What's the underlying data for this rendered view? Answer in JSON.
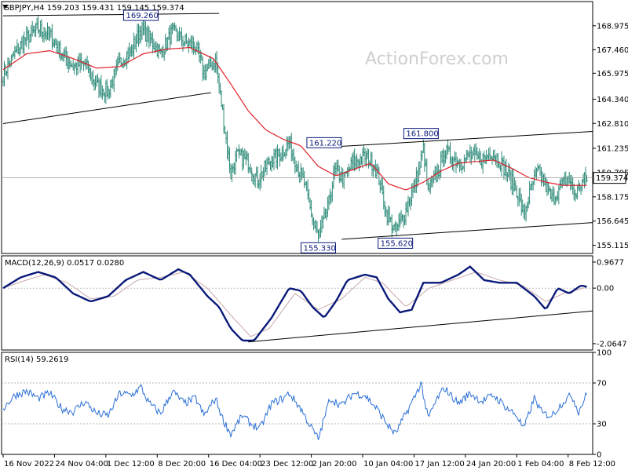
{
  "watermark": "ActionForex.com",
  "colors": {
    "price_bars": "#2e8b7a",
    "ema": "#e0202a",
    "macd": "#0a1a7a",
    "signal": "#c8a8a8",
    "rsi": "#2a6fd6",
    "trendline": "#000000",
    "callout_border": "#0a1a7a",
    "callout_text": "#0a1a7a",
    "frame": "#000000"
  },
  "chart_data": [
    {
      "panel": "price",
      "type": "bar",
      "header": "GBPJPY,H4  159.203 159.431 159.145 159.374",
      "ylim": [
        154.6,
        170.5
      ],
      "y_ticks": [
        168.975,
        167.46,
        165.975,
        164.34,
        162.81,
        161.235,
        159.705,
        158.175,
        156.645,
        155.115
      ],
      "last_price_label": "159.374",
      "last_price": 159.374,
      "x_tick_labels": [
        "16 Nov 2022",
        "24 Nov 04:00",
        "1 Dec 12:00",
        "8 Dec 20:00",
        "16 Dec 04:00",
        "23 Dec 12:00",
        "2 Jan 20:00",
        "10 Jan 04:00",
        "17 Jan 12:00",
        "24 Jan 20:00",
        "1 Feb 04:00",
        "8 Feb 12:00"
      ],
      "x_tick_index": [
        0,
        44,
        88,
        132,
        176,
        220,
        264,
        308,
        352,
        396,
        440,
        484
      ],
      "callouts": [
        {
          "label": "169.260",
          "bar": 118,
          "price": 169.26,
          "side": "above"
        },
        {
          "label": "161.220",
          "bar": 275,
          "price": 161.22,
          "side": "above"
        },
        {
          "label": "161.800",
          "bar": 358,
          "price": 161.8,
          "side": "above"
        },
        {
          "label": "155.330",
          "bar": 270,
          "price": 155.33,
          "side": "below"
        },
        {
          "label": "155.620",
          "bar": 336,
          "price": 155.62,
          "side": "below"
        }
      ],
      "trendlines": [
        {
          "name": "upper-channel-top",
          "bar1": 0,
          "p1": 169.6,
          "bar2": 185,
          "p2": 169.75
        },
        {
          "name": "upper-channel-bottom",
          "bar1": 0,
          "p1": 162.8,
          "bar2": 178,
          "p2": 164.75
        },
        {
          "name": "range-top",
          "bar1": 275,
          "p1": 161.3,
          "bar2": 510,
          "p2": 162.3
        },
        {
          "name": "range-bottom",
          "bar1": 290,
          "p1": 155.5,
          "bar2": 510,
          "p2": 156.55
        }
      ],
      "path_nodes": [
        {
          "i": 0,
          "v": 165.9
        },
        {
          "i": 10,
          "v": 167.2
        },
        {
          "i": 20,
          "v": 168.2
        },
        {
          "i": 30,
          "v": 168.8
        },
        {
          "i": 40,
          "v": 168.4
        },
        {
          "i": 50,
          "v": 167.2
        },
        {
          "i": 60,
          "v": 166.4
        },
        {
          "i": 70,
          "v": 166.6
        },
        {
          "i": 80,
          "v": 165.2
        },
        {
          "i": 90,
          "v": 164.8
        },
        {
          "i": 100,
          "v": 166.7
        },
        {
          "i": 110,
          "v": 167.4
        },
        {
          "i": 118,
          "v": 168.8
        },
        {
          "i": 125,
          "v": 168.2
        },
        {
          "i": 135,
          "v": 167.2
        },
        {
          "i": 145,
          "v": 168.6
        },
        {
          "i": 155,
          "v": 168.0
        },
        {
          "i": 165,
          "v": 167.6
        },
        {
          "i": 172,
          "v": 166.0
        },
        {
          "i": 182,
          "v": 166.8
        },
        {
          "i": 188,
          "v": 163.5
        },
        {
          "i": 195,
          "v": 159.6
        },
        {
          "i": 200,
          "v": 160.8
        },
        {
          "i": 210,
          "v": 160.4
        },
        {
          "i": 218,
          "v": 159.2
        },
        {
          "i": 228,
          "v": 160.4
        },
        {
          "i": 238,
          "v": 160.9
        },
        {
          "i": 245,
          "v": 161.6
        },
        {
          "i": 252,
          "v": 160.1
        },
        {
          "i": 258,
          "v": 159.0
        },
        {
          "i": 265,
          "v": 156.8
        },
        {
          "i": 270,
          "v": 155.6
        },
        {
          "i": 278,
          "v": 157.4
        },
        {
          "i": 284,
          "v": 159.8
        },
        {
          "i": 292,
          "v": 159.3
        },
        {
          "i": 300,
          "v": 160.4
        },
        {
          "i": 310,
          "v": 160.7
        },
        {
          "i": 318,
          "v": 160.2
        },
        {
          "i": 322,
          "v": 159.3
        },
        {
          "i": 328,
          "v": 157.2
        },
        {
          "i": 336,
          "v": 156.0
        },
        {
          "i": 344,
          "v": 157.1
        },
        {
          "i": 350,
          "v": 158.4
        },
        {
          "i": 356,
          "v": 159.8
        },
        {
          "i": 360,
          "v": 161.2
        },
        {
          "i": 364,
          "v": 158.6
        },
        {
          "i": 372,
          "v": 159.6
        },
        {
          "i": 378,
          "v": 161.1
        },
        {
          "i": 385,
          "v": 160.6
        },
        {
          "i": 392,
          "v": 160.3
        },
        {
          "i": 400,
          "v": 160.8
        },
        {
          "i": 410,
          "v": 160.5
        },
        {
          "i": 418,
          "v": 161.0
        },
        {
          "i": 426,
          "v": 160.4
        },
        {
          "i": 432,
          "v": 159.6
        },
        {
          "i": 440,
          "v": 158.6
        },
        {
          "i": 446,
          "v": 157.0
        },
        {
          "i": 452,
          "v": 158.6
        },
        {
          "i": 458,
          "v": 159.8
        },
        {
          "i": 464,
          "v": 159.0
        },
        {
          "i": 470,
          "v": 158.0
        },
        {
          "i": 478,
          "v": 158.8
        },
        {
          "i": 484,
          "v": 159.4
        },
        {
          "i": 490,
          "v": 158.3
        },
        {
          "i": 495,
          "v": 159.0
        },
        {
          "i": 500,
          "v": 159.374
        }
      ],
      "ema_nodes": [
        {
          "i": 0,
          "v": 166.2
        },
        {
          "i": 20,
          "v": 167.2
        },
        {
          "i": 40,
          "v": 167.4
        },
        {
          "i": 60,
          "v": 166.9
        },
        {
          "i": 80,
          "v": 166.3
        },
        {
          "i": 100,
          "v": 166.4
        },
        {
          "i": 120,
          "v": 167.2
        },
        {
          "i": 140,
          "v": 167.5
        },
        {
          "i": 160,
          "v": 167.6
        },
        {
          "i": 180,
          "v": 166.9
        },
        {
          "i": 195,
          "v": 165.3
        },
        {
          "i": 210,
          "v": 163.6
        },
        {
          "i": 225,
          "v": 162.4
        },
        {
          "i": 240,
          "v": 161.8
        },
        {
          "i": 255,
          "v": 161.4
        },
        {
          "i": 270,
          "v": 160.1
        },
        {
          "i": 285,
          "v": 159.5
        },
        {
          "i": 300,
          "v": 159.9
        },
        {
          "i": 315,
          "v": 160.3
        },
        {
          "i": 330,
          "v": 159.0
        },
        {
          "i": 345,
          "v": 158.6
        },
        {
          "i": 360,
          "v": 159.1
        },
        {
          "i": 375,
          "v": 159.8
        },
        {
          "i": 390,
          "v": 160.3
        },
        {
          "i": 405,
          "v": 160.4
        },
        {
          "i": 420,
          "v": 160.5
        },
        {
          "i": 435,
          "v": 160.0
        },
        {
          "i": 450,
          "v": 159.4
        },
        {
          "i": 465,
          "v": 159.1
        },
        {
          "i": 480,
          "v": 158.9
        },
        {
          "i": 500,
          "v": 158.9
        }
      ]
    },
    {
      "panel": "macd",
      "type": "line",
      "header": "MACD(12,26,9) 0.0517 0.0280",
      "ylim": [
        -2.3,
        1.2
      ],
      "y_ticks": [
        0.9677,
        0.0,
        -2.0647
      ],
      "y_tick_labels": [
        "0.9677",
        "0.00",
        "-2.0647"
      ],
      "macd_nodes": [
        {
          "i": 0,
          "v": 0.0
        },
        {
          "i": 15,
          "v": 0.4
        },
        {
          "i": 30,
          "v": 0.6
        },
        {
          "i": 45,
          "v": 0.4
        },
        {
          "i": 60,
          "v": -0.2
        },
        {
          "i": 75,
          "v": -0.5
        },
        {
          "i": 90,
          "v": -0.3
        },
        {
          "i": 105,
          "v": 0.3
        },
        {
          "i": 120,
          "v": 0.6
        },
        {
          "i": 135,
          "v": 0.3
        },
        {
          "i": 150,
          "v": 0.7
        },
        {
          "i": 160,
          "v": 0.5
        },
        {
          "i": 175,
          "v": -0.3
        },
        {
          "i": 185,
          "v": -0.7
        },
        {
          "i": 195,
          "v": -1.5
        },
        {
          "i": 205,
          "v": -1.95
        },
        {
          "i": 215,
          "v": -1.95
        },
        {
          "i": 230,
          "v": -1.1
        },
        {
          "i": 245,
          "v": 0.0
        },
        {
          "i": 255,
          "v": -0.1
        },
        {
          "i": 265,
          "v": -0.7
        },
        {
          "i": 275,
          "v": -1.1
        },
        {
          "i": 285,
          "v": -0.5
        },
        {
          "i": 295,
          "v": 0.3
        },
        {
          "i": 310,
          "v": 0.5
        },
        {
          "i": 320,
          "v": 0.4
        },
        {
          "i": 330,
          "v": -0.4
        },
        {
          "i": 340,
          "v": -0.9
        },
        {
          "i": 350,
          "v": -0.8
        },
        {
          "i": 360,
          "v": 0.2
        },
        {
          "i": 375,
          "v": 0.2
        },
        {
          "i": 390,
          "v": 0.5
        },
        {
          "i": 400,
          "v": 0.8
        },
        {
          "i": 412,
          "v": 0.3
        },
        {
          "i": 425,
          "v": 0.2
        },
        {
          "i": 440,
          "v": 0.2
        },
        {
          "i": 455,
          "v": -0.3
        },
        {
          "i": 465,
          "v": -0.8
        },
        {
          "i": 475,
          "v": 0.0
        },
        {
          "i": 485,
          "v": -0.2
        },
        {
          "i": 495,
          "v": 0.1
        },
        {
          "i": 500,
          "v": 0.05
        }
      ],
      "signal_nodes": [
        {
          "i": 0,
          "v": 0.0
        },
        {
          "i": 20,
          "v": 0.3
        },
        {
          "i": 35,
          "v": 0.5
        },
        {
          "i": 55,
          "v": 0.2
        },
        {
          "i": 75,
          "v": -0.4
        },
        {
          "i": 95,
          "v": -0.3
        },
        {
          "i": 115,
          "v": 0.3
        },
        {
          "i": 135,
          "v": 0.4
        },
        {
          "i": 155,
          "v": 0.6
        },
        {
          "i": 175,
          "v": 0.0
        },
        {
          "i": 195,
          "v": -1.0
        },
        {
          "i": 212,
          "v": -1.8
        },
        {
          "i": 228,
          "v": -1.5
        },
        {
          "i": 250,
          "v": -0.2
        },
        {
          "i": 270,
          "v": -0.8
        },
        {
          "i": 290,
          "v": -0.4
        },
        {
          "i": 310,
          "v": 0.4
        },
        {
          "i": 325,
          "v": 0.2
        },
        {
          "i": 345,
          "v": -0.7
        },
        {
          "i": 365,
          "v": 0.0
        },
        {
          "i": 385,
          "v": 0.3
        },
        {
          "i": 405,
          "v": 0.6
        },
        {
          "i": 425,
          "v": 0.3
        },
        {
          "i": 445,
          "v": 0.1
        },
        {
          "i": 465,
          "v": -0.5
        },
        {
          "i": 480,
          "v": -0.2
        },
        {
          "i": 500,
          "v": 0.03
        }
      ],
      "trendline": {
        "bar1": 210,
        "v1": -2.0,
        "bar2": 510,
        "v2": -0.85
      }
    },
    {
      "panel": "rsi",
      "type": "line",
      "header": "RSI(14) 59.2619",
      "ylim": [
        0,
        100
      ],
      "y_ticks": [
        100,
        70,
        30,
        0
      ],
      "y_tick_labels": [
        "100",
        "70",
        "30",
        "0"
      ],
      "levels": [
        70,
        30
      ],
      "rsi_nodes": [
        {
          "i": 0,
          "v": 45
        },
        {
          "i": 10,
          "v": 58
        },
        {
          "i": 20,
          "v": 62
        },
        {
          "i": 30,
          "v": 55
        },
        {
          "i": 40,
          "v": 60
        },
        {
          "i": 50,
          "v": 45
        },
        {
          "i": 60,
          "v": 42
        },
        {
          "i": 70,
          "v": 52
        },
        {
          "i": 80,
          "v": 40
        },
        {
          "i": 90,
          "v": 38
        },
        {
          "i": 100,
          "v": 60
        },
        {
          "i": 110,
          "v": 58
        },
        {
          "i": 118,
          "v": 66
        },
        {
          "i": 125,
          "v": 50
        },
        {
          "i": 135,
          "v": 40
        },
        {
          "i": 145,
          "v": 62
        },
        {
          "i": 155,
          "v": 50
        },
        {
          "i": 165,
          "v": 55
        },
        {
          "i": 172,
          "v": 38
        },
        {
          "i": 182,
          "v": 55
        },
        {
          "i": 188,
          "v": 35
        },
        {
          "i": 195,
          "v": 20
        },
        {
          "i": 205,
          "v": 38
        },
        {
          "i": 212,
          "v": 30
        },
        {
          "i": 220,
          "v": 25
        },
        {
          "i": 230,
          "v": 50
        },
        {
          "i": 240,
          "v": 55
        },
        {
          "i": 245,
          "v": 60
        },
        {
          "i": 255,
          "v": 45
        },
        {
          "i": 262,
          "v": 30
        },
        {
          "i": 270,
          "v": 15
        },
        {
          "i": 280,
          "v": 55
        },
        {
          "i": 290,
          "v": 48
        },
        {
          "i": 300,
          "v": 60
        },
        {
          "i": 310,
          "v": 58
        },
        {
          "i": 320,
          "v": 45
        },
        {
          "i": 330,
          "v": 28
        },
        {
          "i": 336,
          "v": 20
        },
        {
          "i": 345,
          "v": 40
        },
        {
          "i": 352,
          "v": 55
        },
        {
          "i": 358,
          "v": 70
        },
        {
          "i": 364,
          "v": 35
        },
        {
          "i": 372,
          "v": 55
        },
        {
          "i": 378,
          "v": 65
        },
        {
          "i": 390,
          "v": 50
        },
        {
          "i": 400,
          "v": 60
        },
        {
          "i": 410,
          "v": 52
        },
        {
          "i": 420,
          "v": 58
        },
        {
          "i": 432,
          "v": 45
        },
        {
          "i": 440,
          "v": 38
        },
        {
          "i": 446,
          "v": 25
        },
        {
          "i": 455,
          "v": 55
        },
        {
          "i": 462,
          "v": 40
        },
        {
          "i": 470,
          "v": 38
        },
        {
          "i": 480,
          "v": 52
        },
        {
          "i": 487,
          "v": 58
        },
        {
          "i": 493,
          "v": 42
        },
        {
          "i": 500,
          "v": 59.26
        }
      ]
    }
  ]
}
